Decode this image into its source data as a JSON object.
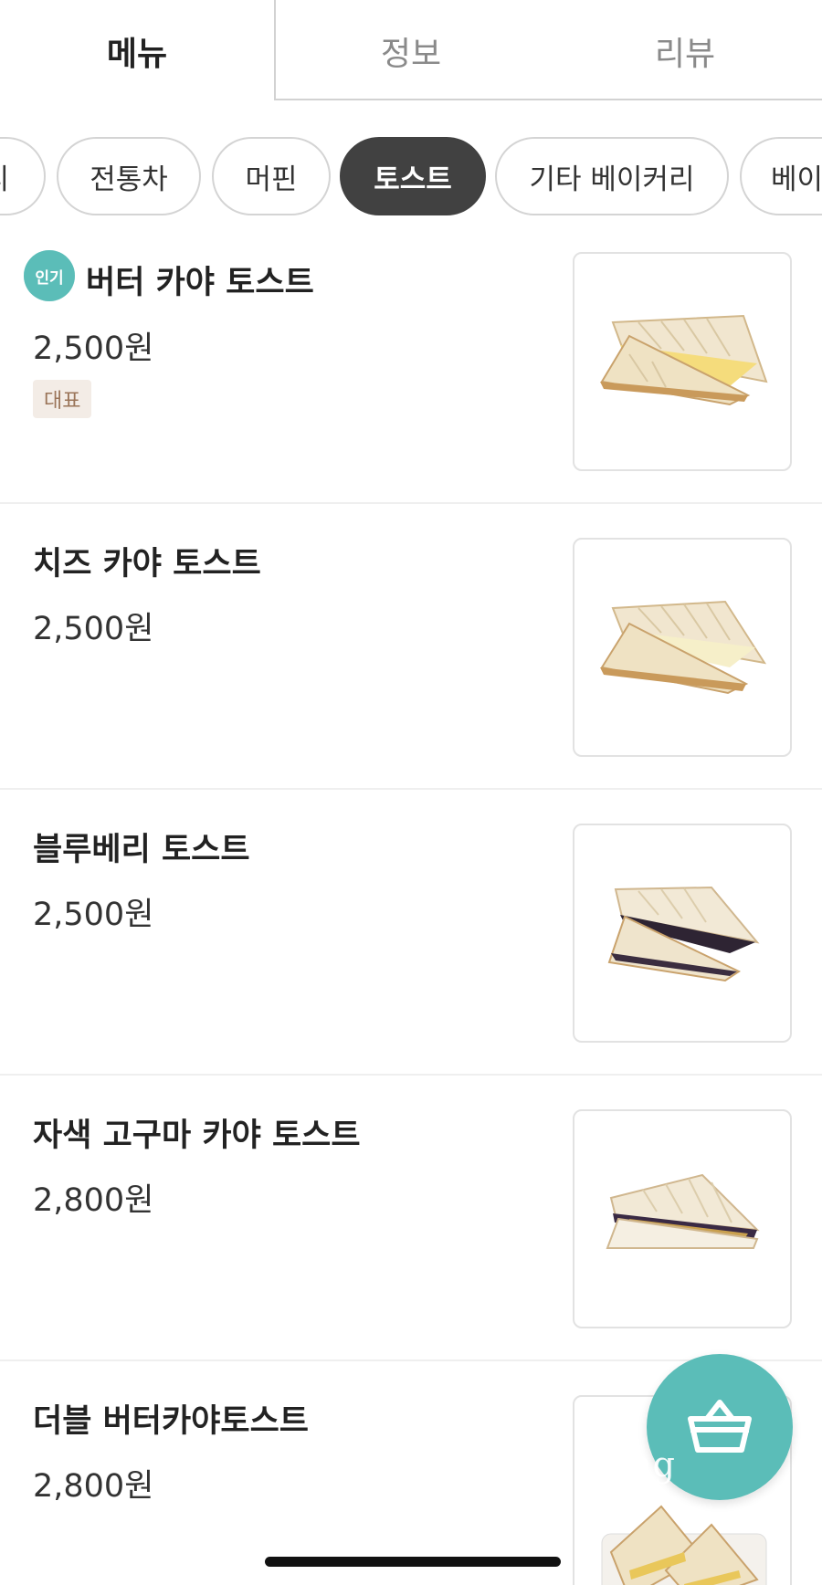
{
  "tabs": {
    "menu": "메뉴",
    "info": "정보",
    "review": "리뷰",
    "active": "menu"
  },
  "categories": {
    "items": [
      "티",
      "전통차",
      "머핀",
      "토스트",
      "기타 베이커리",
      "베이"
    ],
    "active": "토스트"
  },
  "menu_items": [
    {
      "name": "버터 카야 토스트",
      "price": "2,500원",
      "popular_badge": "인기",
      "rep_badge": "대표",
      "image_icon": "sandwich-butter-kaya"
    },
    {
      "name": "치즈 카야 토스트",
      "price": "2,500원",
      "image_icon": "sandwich-cheese-kaya"
    },
    {
      "name": "블루베리 토스트",
      "price": "2,500원",
      "image_icon": "sandwich-blueberry"
    },
    {
      "name": "자색 고구마 카야 토스트",
      "price": "2,800원",
      "image_icon": "sandwich-purple-sweet-potato"
    },
    {
      "name": "더블 버터카야토스트",
      "price": "2,800원",
      "image_icon": "sandwich-double-butter-kaya"
    }
  ],
  "cart": {
    "icon": "basket-icon",
    "watermark": "nang"
  },
  "colors": {
    "accent": "#5bbdb8",
    "chip_active": "#414141",
    "rep_badge_bg": "#f3ece6",
    "rep_badge_text": "#9a7458"
  }
}
